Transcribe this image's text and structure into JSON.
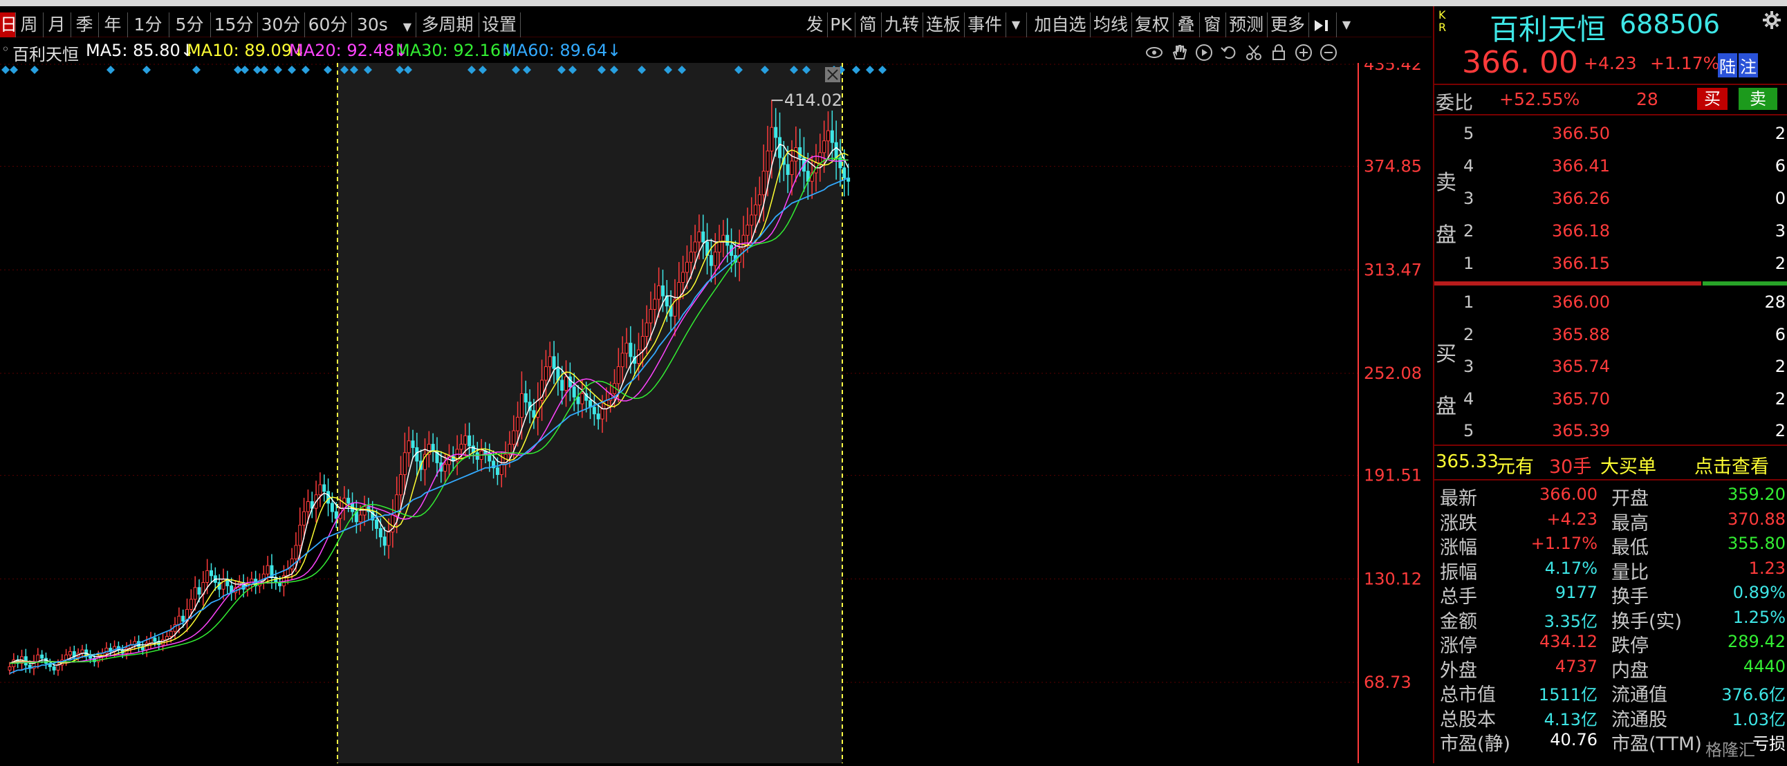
{
  "toolbar": {
    "periods": [
      "日",
      "周",
      "月",
      "季",
      "年",
      "1分",
      "5分",
      "15分",
      "30分",
      "60分",
      "30s",
      "多周期",
      "设置"
    ],
    "right_items": [
      "发",
      "PK",
      "简",
      "九转",
      "连板",
      "事件",
      "加自选",
      "均线",
      "复权",
      "叠",
      "窗",
      "预测",
      "更多"
    ],
    "dropdown_arrow": "▼"
  },
  "legend": {
    "name": "百利天恒",
    "ma5": "MA5: 85.80↓",
    "ma10": "MA10: 89.09↓",
    "ma20": "MA20: 92.48↓",
    "ma30": "MA30: 92.16↓",
    "ma60": "MA60: 89.64↓",
    "icons": [
      "eye-icon",
      "hand-icon",
      "play-icon",
      "undo-icon",
      "scissors-icon",
      "lock-icon",
      "zoom-in-icon",
      "zoom-out-icon"
    ]
  },
  "colors": {
    "up": "#ff3b3b",
    "down": "#3ee6e6",
    "ma5": "#ffffff",
    "ma10": "#ffff33",
    "ma20": "#ff44ff",
    "ma30": "#33ee33",
    "ma60": "#33aaff",
    "grid": "#5a0000",
    "axis": "#ff3b3b"
  },
  "chart_data": {
    "type": "candlestick",
    "y_ticks": [
      "435.42",
      "374.85",
      "313.47",
      "252.08",
      "191.51",
      "130.12",
      "68.73"
    ],
    "peak_label": "414.02",
    "ylim": [
      68.73,
      435.42
    ],
    "closes": [
      78,
      82,
      80,
      84,
      79,
      77,
      81,
      85,
      83,
      80,
      78,
      76,
      79,
      82,
      85,
      87,
      84,
      86,
      88,
      85,
      83,
      81,
      84,
      86,
      89,
      87,
      90,
      88,
      86,
      89,
      91,
      93,
      90,
      88,
      92,
      95,
      93,
      91,
      94,
      96,
      99,
      103,
      108,
      105,
      112,
      118,
      125,
      121,
      128,
      135,
      132,
      128,
      124,
      130,
      126,
      122,
      125,
      128,
      124,
      127,
      130,
      126,
      129,
      133,
      138,
      131,
      128,
      126,
      132,
      136,
      142,
      150,
      162,
      170,
      176,
      172,
      180,
      186,
      182,
      175,
      170,
      166,
      172,
      178,
      175,
      170,
      164,
      168,
      173,
      170,
      165,
      160,
      155,
      150,
      158,
      168,
      180,
      192,
      205,
      212,
      208,
      200,
      195,
      204,
      210,
      206,
      199,
      194,
      198,
      203,
      200,
      207,
      210,
      215,
      209,
      205,
      201,
      206,
      204,
      200,
      196,
      192,
      198,
      204,
      210,
      218,
      226,
      240,
      235,
      230,
      226,
      236,
      248,
      256,
      262,
      255,
      248,
      242,
      250,
      244,
      238,
      234,
      240,
      236,
      232,
      228,
      225,
      231,
      236,
      240,
      246,
      256,
      264,
      270,
      262,
      258,
      266,
      274,
      282,
      290,
      296,
      304,
      298,
      292,
      286,
      296,
      306,
      312,
      318,
      324,
      330,
      336,
      330,
      322,
      316,
      324,
      330,
      334,
      328,
      322,
      318,
      326,
      334,
      340,
      346,
      352,
      358,
      372,
      384,
      398,
      392,
      380,
      376,
      370,
      378,
      386,
      380,
      372,
      366,
      371,
      377,
      383,
      390,
      396,
      389,
      380,
      374,
      368,
      366
    ],
    "ma5": [
      80,
      81,
      82,
      82,
      81,
      80,
      80,
      81,
      82,
      82,
      81,
      79,
      79,
      80,
      82,
      83,
      84,
      85,
      86,
      86,
      85,
      84,
      84,
      84,
      85,
      86,
      87,
      88,
      88,
      88,
      89,
      90,
      91,
      91,
      91,
      92,
      92,
      93,
      93,
      94,
      95,
      97,
      100,
      102,
      105,
      109,
      113,
      118,
      121,
      125,
      128,
      130,
      130,
      130,
      130,
      128,
      127,
      127,
      127,
      126,
      127,
      128,
      128,
      129,
      131,
      131,
      131,
      130,
      131,
      132,
      133,
      137,
      145,
      155,
      165,
      172,
      176,
      179,
      181,
      180,
      177,
      174,
      172,
      172,
      172,
      172,
      171,
      171,
      171,
      171,
      169,
      167,
      163,
      159,
      158,
      160,
      164,
      172,
      182,
      193,
      202,
      205,
      206,
      207,
      206,
      206,
      205,
      203,
      202,
      201,
      200,
      201,
      203,
      206,
      208,
      208,
      207,
      207,
      206,
      205,
      203,
      200,
      199,
      199,
      201,
      206,
      212,
      219,
      226,
      232,
      234,
      236,
      238,
      244,
      249,
      254,
      256,
      254,
      251,
      248,
      246,
      244,
      242,
      239,
      237,
      235,
      233,
      231,
      231,
      232,
      235,
      240,
      246,
      252,
      257,
      261,
      263,
      265,
      268,
      274,
      280,
      288,
      294,
      298,
      298,
      297,
      297,
      300,
      305,
      310,
      317,
      324,
      329,
      331,
      331,
      330,
      330,
      330,
      330,
      330,
      328,
      327,
      327,
      328,
      331,
      338,
      344,
      352,
      363,
      375,
      384,
      388,
      387,
      383,
      381,
      380,
      379,
      379,
      378,
      376,
      374,
      374,
      376,
      380,
      384,
      386,
      384,
      379,
      374
    ],
    "ma60": [
      74,
      75,
      76,
      76,
      77,
      77,
      78,
      78,
      79,
      79,
      80,
      80,
      81,
      81,
      82,
      82,
      83,
      83,
      84,
      84,
      85,
      85,
      86,
      86,
      87,
      87,
      88,
      89,
      89,
      90,
      91,
      91,
      92,
      93,
      94,
      95,
      96,
      97,
      98,
      99,
      100,
      102,
      103,
      104,
      106,
      107,
      109,
      111,
      112,
      114,
      116,
      117,
      118,
      120,
      121,
      122,
      123,
      124,
      125,
      126,
      127,
      128,
      129,
      130,
      131,
      132,
      133,
      134,
      135,
      136,
      138,
      140,
      142,
      144,
      146,
      148,
      150,
      152,
      154,
      155,
      156,
      157,
      158,
      159,
      160,
      161,
      162,
      163,
      164,
      165,
      166,
      167,
      167,
      168,
      168,
      169,
      170,
      171,
      173,
      175,
      177,
      178,
      179,
      181,
      182,
      183,
      184,
      185,
      186,
      187,
      188,
      189,
      190,
      191,
      192,
      193,
      194,
      195,
      196,
      196,
      197,
      197,
      198,
      198,
      199,
      200,
      201,
      203,
      205,
      207,
      209,
      211,
      213,
      215,
      217,
      219,
      221,
      223,
      225,
      227,
      228,
      229,
      230,
      231,
      232,
      233,
      234,
      235,
      236,
      237,
      238,
      240,
      242,
      245,
      247,
      249,
      252,
      255,
      258,
      261,
      264,
      268,
      271,
      274,
      277,
      280,
      283,
      287,
      290,
      293,
      297,
      300,
      303,
      306,
      308,
      310,
      312,
      314,
      316,
      318,
      320,
      322,
      324,
      326,
      328,
      331,
      333,
      336,
      339,
      342,
      345,
      347,
      349,
      351,
      353,
      354,
      355,
      356,
      357,
      358,
      359,
      360,
      361,
      363,
      364,
      365,
      366,
      367,
      368
    ]
  },
  "quote": {
    "kr": "K\nR",
    "name": "百利天恒",
    "code": "688506",
    "price": "366. 00",
    "change": "+4.23",
    "pct": "+1.17%",
    "tag1": "陆",
    "tag2": "注",
    "weibi_label": "委比",
    "weibi_value": "+52.55%",
    "weibi_count": "28",
    "buy_btn": "买",
    "sell_btn": "卖",
    "sell_side_label": "卖\n盘",
    "buy_side_label": "买\n盘",
    "asks": [
      {
        "lvl": "5",
        "price": "366.50",
        "vol": "2"
      },
      {
        "lvl": "4",
        "price": "366.41",
        "vol": "6"
      },
      {
        "lvl": "3",
        "price": "366.26",
        "vol": "0"
      },
      {
        "lvl": "2",
        "price": "366.18",
        "vol": "3"
      },
      {
        "lvl": "1",
        "price": "366.15",
        "vol": "2"
      }
    ],
    "bids": [
      {
        "lvl": "1",
        "price": "366.00",
        "vol": "28"
      },
      {
        "lvl": "2",
        "price": "365.88",
        "vol": "6"
      },
      {
        "lvl": "3",
        "price": "365.74",
        "vol": "2"
      },
      {
        "lvl": "4",
        "price": "365.70",
        "vol": "2"
      },
      {
        "lvl": "5",
        "price": "365.39",
        "vol": "2"
      }
    ],
    "bigorder": {
      "price": "365.33",
      "unit": "元有",
      "hands": "30手",
      "text": "大买单",
      "link": "点击查看"
    },
    "stats": [
      [
        "最新",
        "366.00",
        "#ff3b3b",
        "开盘",
        "359.20",
        "#33ee33"
      ],
      [
        "涨跌",
        "+4.23",
        "#ff3b3b",
        "最高",
        "370.88",
        "#ff3b3b"
      ],
      [
        "涨幅",
        "+1.17%",
        "#ff3b3b",
        "最低",
        "355.80",
        "#33ee33"
      ],
      [
        "振幅",
        "4.17%",
        "#3ee6e6",
        "量比",
        "1.23",
        "#ff3b3b"
      ],
      [
        "总手",
        "9177",
        "#3ee6e6",
        "换手",
        "0.89%",
        "#3ee6e6"
      ],
      [
        "金额",
        "3.35亿",
        "#3ee6e6",
        "换手(实)",
        "1.25%",
        "#3ee6e6"
      ],
      [
        "涨停",
        "434.12",
        "#ff3b3b",
        "跌停",
        "289.42",
        "#33ee33"
      ],
      [
        "外盘",
        "4737",
        "#ff3b3b",
        "内盘",
        "4440",
        "#33ee33"
      ],
      [
        "总市值",
        "1511亿",
        "#3ee6e6",
        "流通值",
        "376.6亿",
        "#3ee6e6"
      ],
      [
        "总股本",
        "4.13亿",
        "#3ee6e6",
        "流通股",
        "1.03亿",
        "#3ee6e6"
      ],
      [
        "市盈(静)",
        "40.76",
        "#ffffff",
        "市盈(TTM)",
        "亏损",
        "#ffffff"
      ]
    ],
    "watermark": "格隆汇"
  }
}
